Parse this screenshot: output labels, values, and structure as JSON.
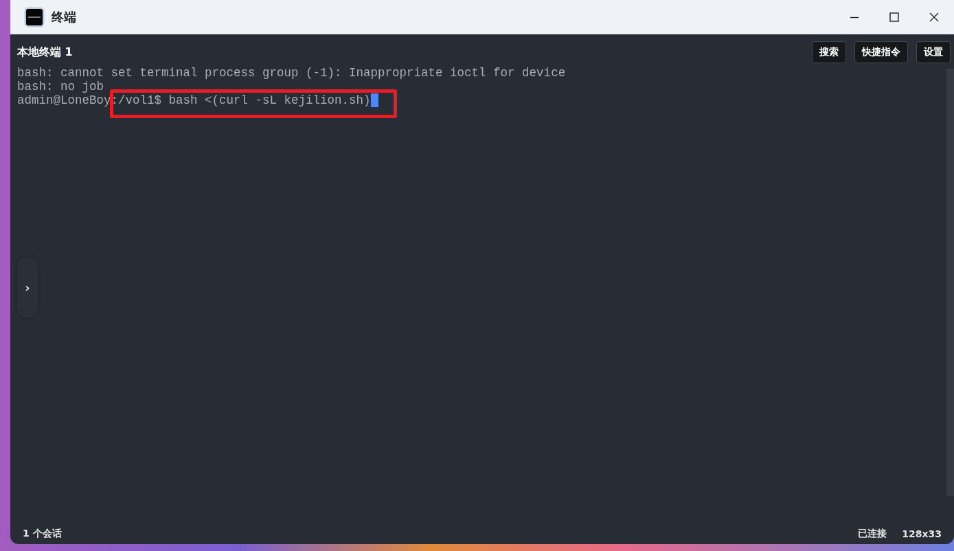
{
  "window": {
    "title": "终端"
  },
  "session": {
    "title": "本地终端 1"
  },
  "toolbar": {
    "buttons": [
      "搜索",
      "快捷指令",
      "设置"
    ]
  },
  "terminal": {
    "lines": [
      "bash: cannot set terminal process group (-1): Inappropriate ioctl for device",
      "bash: no job"
    ],
    "prompt": {
      "user_host": "admin@LoneBoy",
      "path_and_command": ":/vol1$ bash <(curl -sL kejilion.sh)"
    },
    "cursor": true,
    "highlight": true
  },
  "sidebar_toggle": {
    "label": "›"
  },
  "status_bar": {
    "sessions": "1 个会话",
    "connection": "已连接",
    "size": "128x33"
  }
}
